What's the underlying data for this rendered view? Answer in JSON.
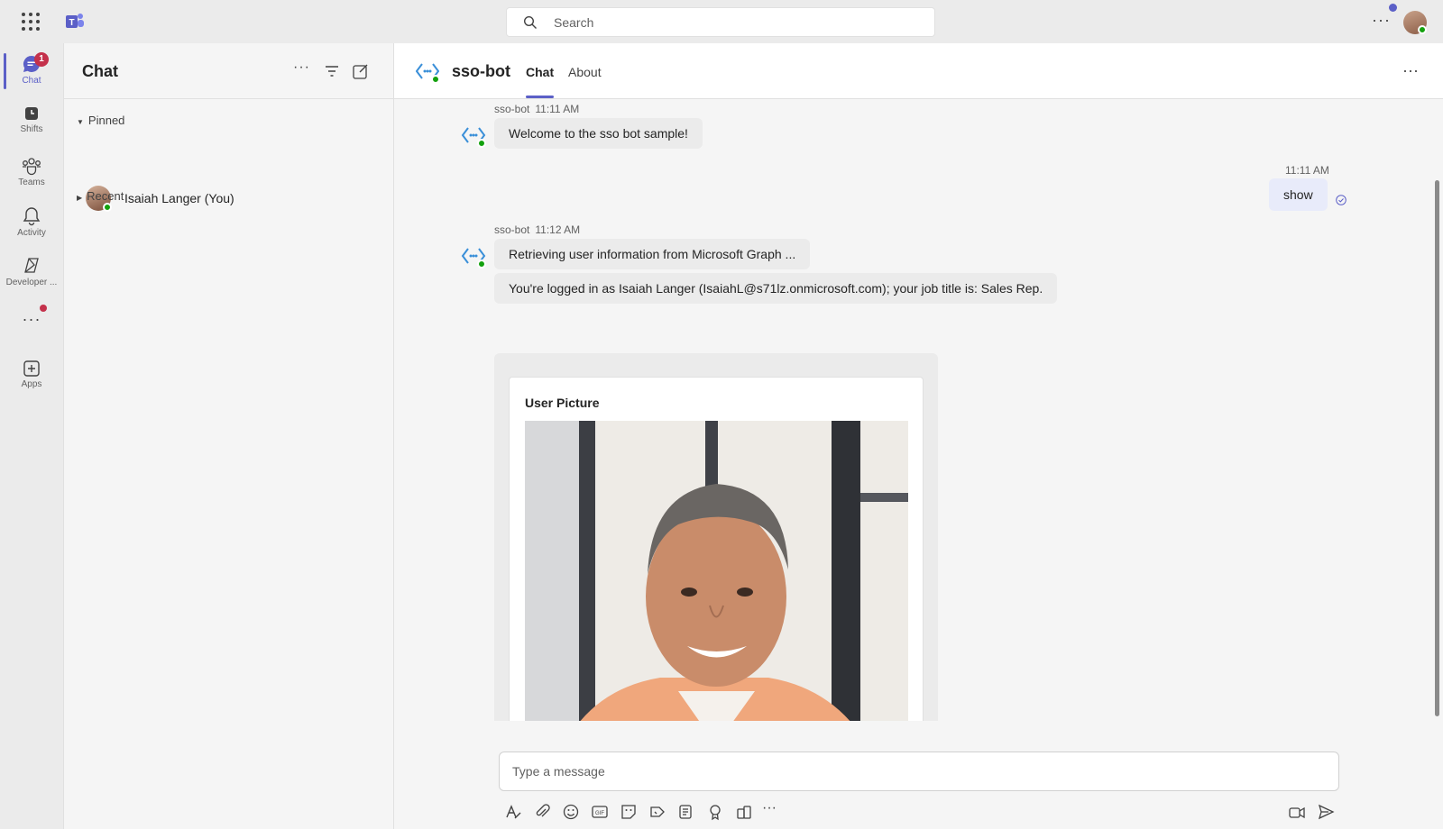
{
  "topbar": {
    "search_placeholder": "Search",
    "more_label": "···"
  },
  "rail": {
    "items": [
      {
        "label": "Chat",
        "icon": "chat-icon",
        "badge": "1",
        "active": true
      },
      {
        "label": "Shifts",
        "icon": "shifts-icon"
      },
      {
        "label": "Teams",
        "icon": "teams-icon"
      },
      {
        "label": "Activity",
        "icon": "bell-icon"
      },
      {
        "label": "Developer ...",
        "icon": "developer-portal-icon"
      },
      {
        "label": "···",
        "icon": "more-apps-icon"
      },
      {
        "label": "Apps",
        "icon": "add-apps-icon"
      }
    ]
  },
  "chatlist": {
    "title": "Chat",
    "pinned_label": "Pinned",
    "recent_label": "Recent",
    "pinned_items": [
      {
        "name": "Isaiah Langer (You)"
      }
    ]
  },
  "conversation": {
    "bot_name": "sso-bot",
    "tabs": [
      {
        "label": "Chat",
        "active": true
      },
      {
        "label": "About",
        "active": false
      }
    ],
    "messages": [
      {
        "sender": "sso-bot",
        "time": "11:11 AM",
        "text": "Welcome to the sso bot sample!"
      },
      {
        "sender": "me",
        "time": "11:11 AM",
        "text": "show"
      },
      {
        "sender": "sso-bot",
        "time": "11:12 AM",
        "text": "Retrieving user information from Microsoft Graph ..."
      },
      {
        "sender": "sso-bot",
        "text": "You're logged in as Isaiah Langer (IsaiahL@s71lz.onmicrosoft.com); your job title is: Sales Rep."
      }
    ],
    "card": {
      "title": "User Picture"
    }
  },
  "compose": {
    "placeholder": "Type a message"
  },
  "colors": {
    "accent": "#5b5fc7",
    "badge": "#c4314b",
    "presence": "#13a10e",
    "my_bubble": "#e8ebfa"
  }
}
